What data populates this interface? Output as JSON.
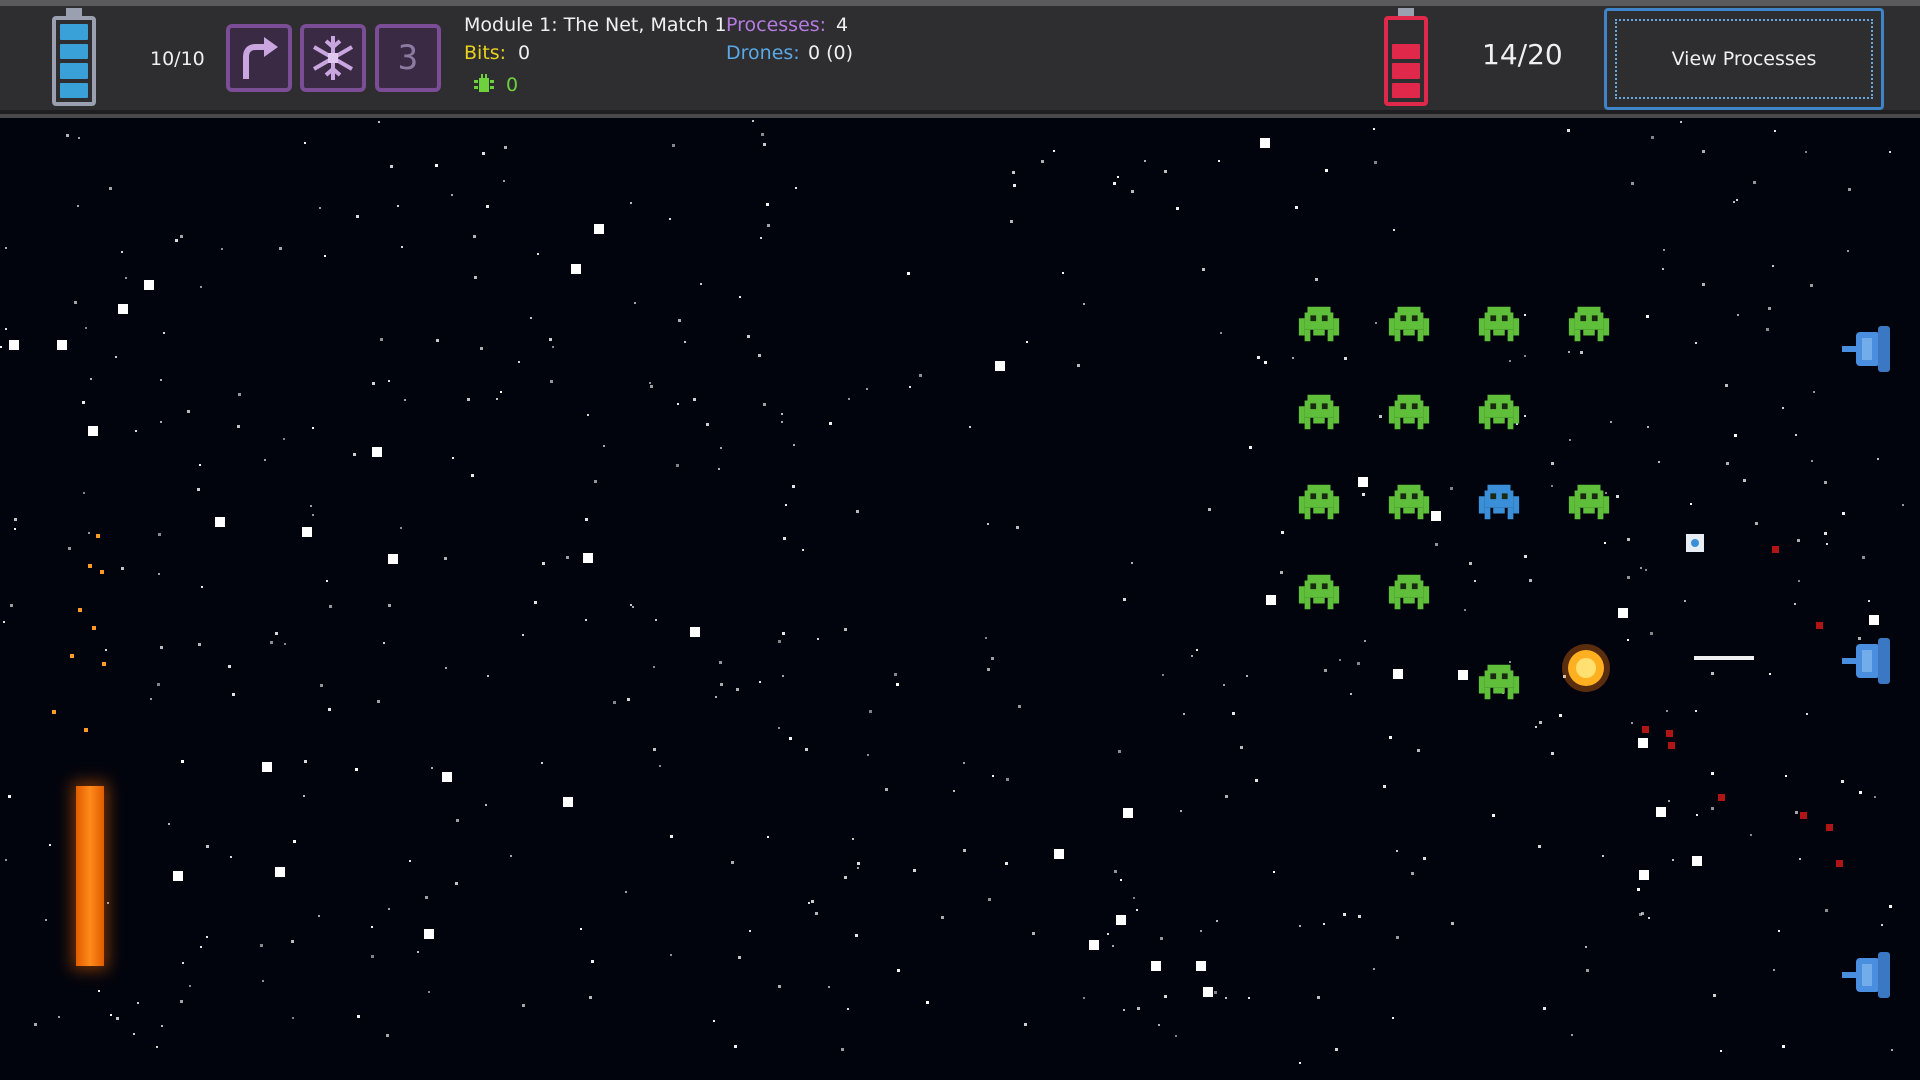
{
  "hud": {
    "player_health": "10/10",
    "ability_3_label": "3",
    "match_title": "Module 1: The Net, Match 1",
    "bits_label": "Bits:",
    "bits_value": "0",
    "bug_count": "0",
    "processes_label": "Processes:",
    "processes_value": "4",
    "drones_label": "Drones:",
    "drones_value": "0 (0)",
    "enemy_count": "14/20",
    "view_processes_label": "View Processes"
  },
  "colors": {
    "player_battery": "#3aa0d8",
    "enemy_battery": "#e0284a",
    "bits": "#e8d21e",
    "processes": "#b57be0",
    "drones": "#5aa8e6",
    "bug": "#6ed23c",
    "invader": "#5fbf3a",
    "invader_special": "#3a8fd8",
    "turret": "#4a8ee0",
    "energy_bar": "#ff7a10"
  },
  "icons": {
    "ability_1": "bent-arrow-icon",
    "ability_2": "snowflake-icon",
    "bug": "bug-icon"
  }
}
